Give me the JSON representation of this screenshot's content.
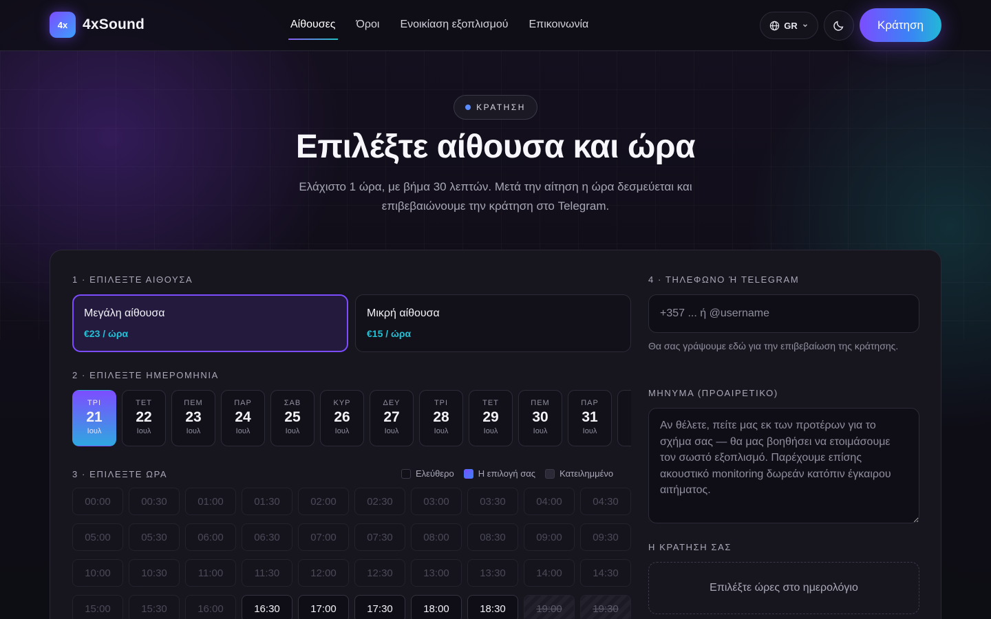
{
  "brand": {
    "mark": "4x",
    "name": "4xSound"
  },
  "nav": [
    {
      "label": "Αίθουσες",
      "active": true
    },
    {
      "label": "Όροι",
      "active": false
    },
    {
      "label": "Ενοικίαση εξοπλισμού",
      "active": false
    },
    {
      "label": "Επικοινωνία",
      "active": false
    }
  ],
  "header": {
    "lang": "GR",
    "book_label": "Κράτηση"
  },
  "hero": {
    "pill": "ΚΡΑΤΗΣΗ",
    "title": "Επιλέξτε αίθουσα και ώρα",
    "subtitle": "Ελάχιστο 1 ώρα, με βήμα 30 λεπτών. Μετά την αίτηση η ώρα δεσμεύεται και επιβεβαιώνουμε την κράτηση στο Telegram."
  },
  "step1": {
    "label": "1 · ΕΠΙΛΕΞΤΕ ΑΙΘΟΥΣΑ",
    "rooms": [
      {
        "name": "Μεγάλη αίθουσα",
        "price": "€23 / ώρα",
        "selected": true
      },
      {
        "name": "Μικρή αίθουσα",
        "price": "€15 / ώρα",
        "selected": false
      }
    ]
  },
  "step2": {
    "label": "2 · ΕΠΙΛΕΞΤΕ ΗΜΕΡΟΜΗΝΙΑ",
    "dates": [
      {
        "dow": "ΤΡΙ",
        "day": "21",
        "month": "Ιουλ",
        "selected": true
      },
      {
        "dow": "ΤΕΤ",
        "day": "22",
        "month": "Ιουλ"
      },
      {
        "dow": "ΠΕΜ",
        "day": "23",
        "month": "Ιουλ"
      },
      {
        "dow": "ΠΑΡ",
        "day": "24",
        "month": "Ιουλ"
      },
      {
        "dow": "ΣΑΒ",
        "day": "25",
        "month": "Ιουλ"
      },
      {
        "dow": "ΚΥΡ",
        "day": "26",
        "month": "Ιουλ"
      },
      {
        "dow": "ΔΕΥ",
        "day": "27",
        "month": "Ιουλ"
      },
      {
        "dow": "ΤΡΙ",
        "day": "28",
        "month": "Ιουλ"
      },
      {
        "dow": "ΤΕΤ",
        "day": "29",
        "month": "Ιουλ"
      },
      {
        "dow": "ΠΕΜ",
        "day": "30",
        "month": "Ιουλ"
      },
      {
        "dow": "ΠΑΡ",
        "day": "31",
        "month": "Ιουλ"
      },
      {
        "dow": "",
        "day": "",
        "month": ""
      }
    ]
  },
  "step3": {
    "label": "3 · ΕΠΙΛΕΞΤΕ ΩΡΑ",
    "legend": {
      "free": "Ελεύθερο",
      "selected": "Η επιλογή σας",
      "busy": "Κατειλημμένο"
    },
    "slots": [
      {
        "time": "00:00",
        "state": "past"
      },
      {
        "time": "00:30",
        "state": "past"
      },
      {
        "time": "01:00",
        "state": "past"
      },
      {
        "time": "01:30",
        "state": "past"
      },
      {
        "time": "02:00",
        "state": "past"
      },
      {
        "time": "02:30",
        "state": "past"
      },
      {
        "time": "03:00",
        "state": "past"
      },
      {
        "time": "03:30",
        "state": "past"
      },
      {
        "time": "04:00",
        "state": "past"
      },
      {
        "time": "04:30",
        "state": "past"
      },
      {
        "time": "05:00",
        "state": "past"
      },
      {
        "time": "05:30",
        "state": "past"
      },
      {
        "time": "06:00",
        "state": "past"
      },
      {
        "time": "06:30",
        "state": "past"
      },
      {
        "time": "07:00",
        "state": "past"
      },
      {
        "time": "07:30",
        "state": "past"
      },
      {
        "time": "08:00",
        "state": "past"
      },
      {
        "time": "08:30",
        "state": "past"
      },
      {
        "time": "09:00",
        "state": "past"
      },
      {
        "time": "09:30",
        "state": "past"
      },
      {
        "time": "10:00",
        "state": "past"
      },
      {
        "time": "10:30",
        "state": "past"
      },
      {
        "time": "11:00",
        "state": "past"
      },
      {
        "time": "11:30",
        "state": "past"
      },
      {
        "time": "12:00",
        "state": "past"
      },
      {
        "time": "12:30",
        "state": "past"
      },
      {
        "time": "13:00",
        "state": "past"
      },
      {
        "time": "13:30",
        "state": "past"
      },
      {
        "time": "14:00",
        "state": "past"
      },
      {
        "time": "14:30",
        "state": "past"
      },
      {
        "time": "15:00",
        "state": "past"
      },
      {
        "time": "15:30",
        "state": "past"
      },
      {
        "time": "16:00",
        "state": "past"
      },
      {
        "time": "16:30",
        "state": "free"
      },
      {
        "time": "17:00",
        "state": "free"
      },
      {
        "time": "17:30",
        "state": "free"
      },
      {
        "time": "18:00",
        "state": "free"
      },
      {
        "time": "18:30",
        "state": "free"
      },
      {
        "time": "19:00",
        "state": "busy"
      },
      {
        "time": "19:30",
        "state": "busy"
      }
    ]
  },
  "step4": {
    "label": "4 · ΤΗΛΕΦΩΝΟ Ή TELEGRAM",
    "placeholder": "+357 ... ή @username",
    "hint": "Θα σας γράψουμε εδώ για την επιβεβαίωση της κράτησης."
  },
  "message": {
    "label": "ΜΗΝΥΜΑ (ΠΡΟΑΙΡΕΤΙΚΟ)",
    "placeholder": "Αν θέλετε, πείτε μας εκ των προτέρων για το σχήμα σας — θα μας βοηθήσει να ετοιμάσουμε τον σωστό εξοπλισμό. Παρέχουμε επίσης ακουστικό monitoring δωρεάν κατόπιν έγκαιρου αιτήματος."
  },
  "summary": {
    "label": "Η ΚΡΑΤΗΣΗ ΣΑΣ",
    "empty": "Επιλέξτε ώρες στο ημερολόγιο"
  }
}
